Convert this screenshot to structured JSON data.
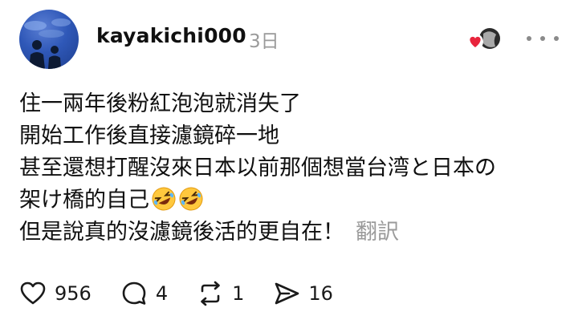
{
  "post": {
    "username": "kayakichi000",
    "timestamp": "3日",
    "lines": [
      "住一兩年後粉紅泡泡就消失了",
      "開始工作後直接濾鏡碎一地",
      "甚至還想打醒沒來日本以前那個想當台湾と日本の",
      "架け橋的自己",
      "但是說真的沒濾鏡後活的更自在！"
    ],
    "emoji": [
      "rolling-on-floor-laughing",
      "rolling-on-floor-laughing"
    ],
    "translate_label": "翻訳"
  },
  "actions": {
    "likes": "956",
    "comments": "4",
    "reposts": "1",
    "shares": "16"
  },
  "colors": {
    "text": "#101010",
    "muted": "#9a9a9a",
    "heart_badge": "#e8243c"
  }
}
